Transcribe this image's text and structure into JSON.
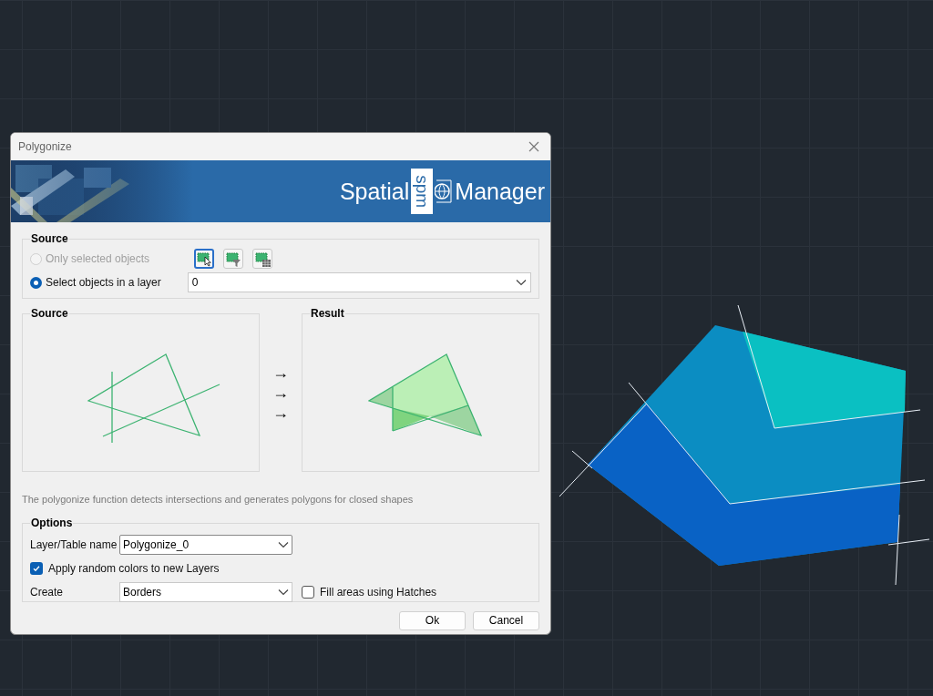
{
  "dialog": {
    "title": "Polygonize",
    "banner": {
      "logo_left": "Spatial",
      "logo_mark": "spm",
      "logo_right": "Manager"
    }
  },
  "source": {
    "title": "Source",
    "options": [
      {
        "label": "Only selected objects",
        "selected": false,
        "disabled": true
      },
      {
        "label": "Select objects in a layer",
        "selected": true,
        "disabled": false
      }
    ],
    "tools": [
      {
        "kind": "pick",
        "selected": true
      },
      {
        "kind": "filter",
        "selected": false
      },
      {
        "kind": "table",
        "selected": false
      }
    ],
    "layer": {
      "value": "0"
    }
  },
  "preview": {
    "source_title": "Source",
    "result_title": "Result",
    "arrows": [
      "→",
      "→",
      "→"
    ]
  },
  "description": "The polygonize function detects intersections and generates polygons for closed shapes",
  "options": {
    "title": "Options",
    "layer_name_label": "Layer/Table name",
    "layer_name": "Polygonize_0",
    "random_colors": {
      "label": "Apply random colors to new Layers",
      "checked": true
    },
    "create_label": "Create",
    "create": "Borders",
    "hatches": {
      "label": "Fill areas using Hatches",
      "checked": false
    }
  },
  "buttons": [
    "Ok",
    "Cancel"
  ]
}
